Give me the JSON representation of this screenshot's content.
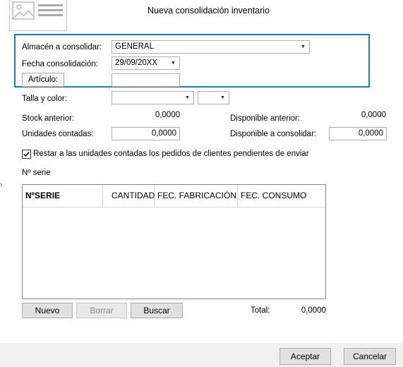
{
  "window": {
    "title": "Nueva consolidación inventario"
  },
  "icons": {
    "document": "document-image-icon"
  },
  "form": {
    "almacen": {
      "label": "Almacén a consolidar:",
      "value": "GENERAL"
    },
    "fecha": {
      "label": "Fecha consolidación:",
      "value": "29/09/20XX"
    },
    "articulo": {
      "button_label": "Artículo:",
      "value": ""
    },
    "talla": {
      "label": "Talla y color:",
      "talla_value": "",
      "color_value": ""
    },
    "stock_anterior": {
      "label": "Stock anterior:",
      "value": "0,0000"
    },
    "disponible_anterior": {
      "label": "Disponible anterior:",
      "value": "0,0000"
    },
    "unidades_contadas": {
      "label": "Unidades contadas:",
      "value": "0,0000"
    },
    "disponible_consolidar": {
      "label": "Disponible a consolidar:",
      "value": "0,0000"
    },
    "restar_checkbox": {
      "label": "Restar a las unidades contadas los pedidos de clientes pendientes de enviar",
      "checked": true
    },
    "nserie_label": "Nº serie"
  },
  "grid": {
    "columns": [
      "NºSERIE",
      "CANTIDAD",
      "FEC. FABRICACIÓN",
      "FEC. CONSUMO"
    ],
    "rows": []
  },
  "grid_buttons": {
    "nuevo": "Nuevo",
    "borrar": "Borrar",
    "buscar": "Buscar"
  },
  "total": {
    "label": "Total:",
    "value": "0,0000"
  },
  "footer": {
    "aceptar": "Aceptar",
    "cancelar": "Cancelar"
  },
  "colors": {
    "highlight_border": "#1a7dc4",
    "button_bg": "#e1e1e1",
    "footer_bg": "#f0f0f0"
  }
}
